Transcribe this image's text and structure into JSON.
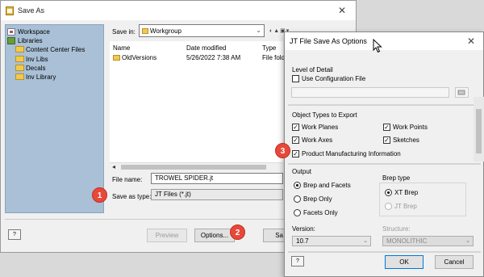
{
  "save_as": {
    "title": "Save As",
    "close_glyph": "✕",
    "tree": [
      {
        "label": "Workspace",
        "icon": "workspace-icon"
      },
      {
        "label": "Libraries",
        "icon": "library-icon"
      },
      {
        "label": "Content Center Files",
        "icon": "folder-icon"
      },
      {
        "label": "Inv Libs",
        "icon": "folder-icon"
      },
      {
        "label": "Decals",
        "icon": "folder-icon"
      },
      {
        "label": "Inv Library",
        "icon": "folder-icon"
      }
    ],
    "save_in_label": "Save in:",
    "save_in_value": "Workgroup",
    "columns": {
      "name": "Name",
      "date": "Date modified",
      "type": "Type"
    },
    "files": [
      {
        "name": "OldVersions",
        "date": "5/26/2022 7:38 AM",
        "type": "File fold"
      }
    ],
    "file_name_label": "File name:",
    "file_name_value": "TROWEL SPIDER.jt",
    "save_as_type_label": "Save as type:",
    "save_as_type_value": "JT Files (*.jt)",
    "preview_button": "Preview",
    "options_button": "Options...",
    "save_button": "Sa",
    "help_glyph": "?"
  },
  "jt_options": {
    "title": "JT File Save As Options",
    "close_glyph": "✕",
    "level_of_detail": {
      "label": "Level of Detail",
      "use_config_file": {
        "label": "Use Configuration File",
        "checked": false
      }
    },
    "object_types": {
      "label": "Object Types to Export",
      "items": [
        {
          "key": "work_planes",
          "label": "Work Planes",
          "checked": true
        },
        {
          "key": "work_points",
          "label": "Work Points",
          "checked": true
        },
        {
          "key": "work_axes",
          "label": "Work Axes",
          "checked": true
        },
        {
          "key": "sketches",
          "label": "Sketches",
          "checked": true
        },
        {
          "key": "pmi",
          "label": "Product Manufacturing Information",
          "checked": true
        }
      ]
    },
    "output": {
      "label": "Output",
      "options": [
        {
          "label": "Brep and Facets",
          "selected": true
        },
        {
          "label": "Brep Only",
          "selected": false
        },
        {
          "label": "Facets Only",
          "selected": false
        }
      ]
    },
    "brep_type": {
      "label": "Brep type",
      "options": [
        {
          "label": "XT Brep",
          "selected": true,
          "enabled": true
        },
        {
          "label": "JT Brep",
          "selected": false,
          "enabled": false
        }
      ]
    },
    "version_label": "Version:",
    "version_value": "10.7",
    "structure_label": "Structure:",
    "structure_value": "MONOLITHIC",
    "ok_button": "OK",
    "cancel_button": "Cancel",
    "help_glyph": "?"
  },
  "badges": {
    "one": "1",
    "two": "2",
    "three": "3"
  },
  "colors": {
    "badge": "#e8483a",
    "left_pane": "#a9c0d6",
    "focus_border": "#0078d7"
  }
}
